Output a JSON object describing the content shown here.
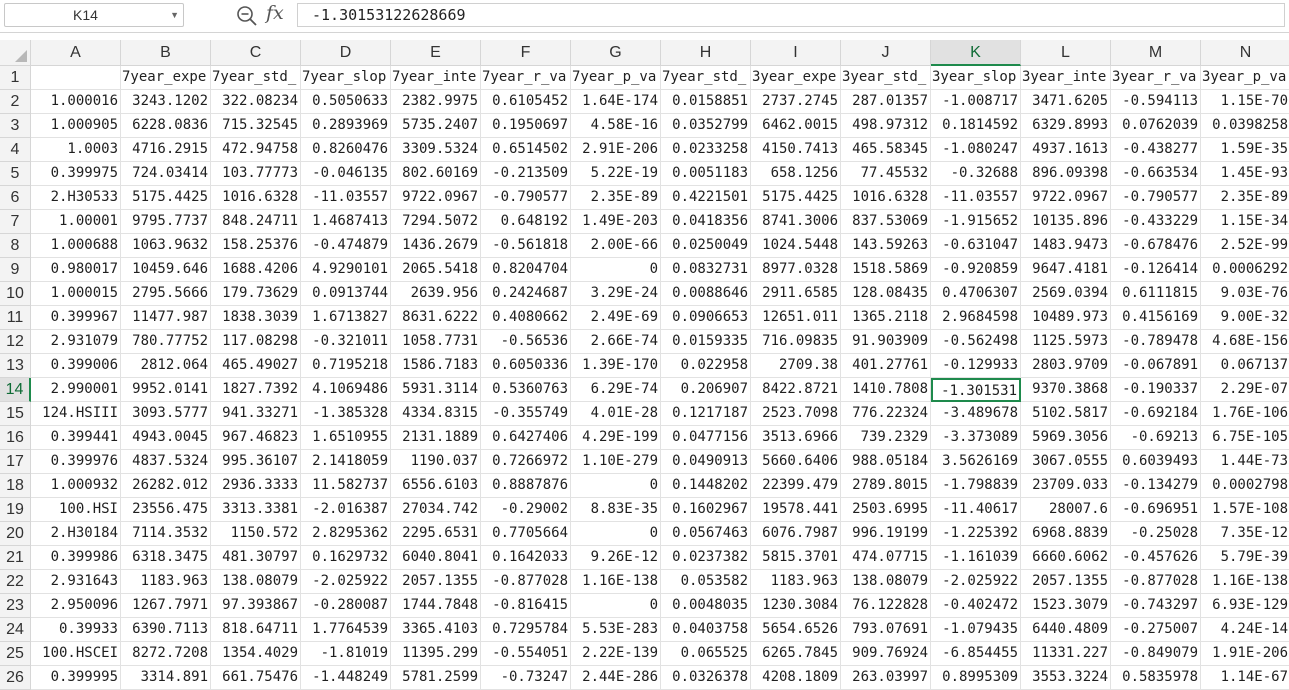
{
  "formula_bar": {
    "name_box": "K14",
    "fx_label": "fx",
    "formula_value": "-1.30153122628669"
  },
  "sheet": {
    "active_cell": {
      "row": 13,
      "col": 10
    },
    "columns": [
      "A",
      "B",
      "C",
      "D",
      "E",
      "F",
      "G",
      "H",
      "I",
      "J",
      "K",
      "L",
      "M",
      "N"
    ],
    "row_numbers": [
      "1",
      "2",
      "3",
      "4",
      "5",
      "6",
      "7",
      "8",
      "9",
      "10",
      "11",
      "12",
      "13",
      "14",
      "15",
      "16",
      "17",
      "18",
      "19",
      "20",
      "21",
      "22",
      "23",
      "24",
      "25",
      "26"
    ],
    "rows": [
      [
        "",
        "7year_expe",
        "7year_std_",
        "7year_slop",
        "7year_inte",
        "7year_r_va",
        "7year_p_va",
        "7year_std_",
        "3year_expe",
        "3year_std_",
        "3year_slop",
        "3year_inte",
        "3year_r_va",
        "3year_p_va"
      ],
      [
        "1.000016",
        "3243.1202",
        "322.08234",
        "0.5050633",
        "2382.9975",
        "0.6105452",
        "1.64E-174",
        "0.0158851",
        "2737.2745",
        "287.01357",
        "-1.008717",
        "3471.6205",
        "-0.594113",
        "1.15E-70"
      ],
      [
        "1.000905",
        "6228.0836",
        "715.32545",
        "0.2893969",
        "5735.2407",
        "0.1950697",
        "4.58E-16",
        "0.0352799",
        "6462.0015",
        "498.97312",
        "0.1814592",
        "6329.8993",
        "0.0762039",
        "0.0398258"
      ],
      [
        "1.0003",
        "4716.2915",
        "472.94758",
        "0.8260476",
        "3309.5324",
        "0.6514502",
        "2.91E-206",
        "0.0233258",
        "4150.7413",
        "465.58345",
        "-1.080247",
        "4937.1613",
        "-0.438277",
        "1.59E-35"
      ],
      [
        "0.399975",
        "724.03414",
        "103.77773",
        "-0.046135",
        "802.60169",
        "-0.213509",
        "5.22E-19",
        "0.0051183",
        "658.1256",
        "77.45532",
        "-0.32688",
        "896.09398",
        "-0.663534",
        "1.45E-93"
      ],
      [
        "2.H30533",
        "5175.4425",
        "1016.6328",
        "-11.03557",
        "9722.0967",
        "-0.790577",
        "2.35E-89",
        "0.4221501",
        "5175.4425",
        "1016.6328",
        "-11.03557",
        "9722.0967",
        "-0.790577",
        "2.35E-89"
      ],
      [
        "1.00001",
        "9795.7737",
        "848.24711",
        "1.4687413",
        "7294.5072",
        "0.648192",
        "1.49E-203",
        "0.0418356",
        "8741.3006",
        "837.53069",
        "-1.915652",
        "10135.896",
        "-0.433229",
        "1.15E-34"
      ],
      [
        "1.000688",
        "1063.9632",
        "158.25376",
        "-0.474879",
        "1436.2679",
        "-0.561818",
        "2.00E-66",
        "0.0250049",
        "1024.5448",
        "143.59263",
        "-0.631047",
        "1483.9473",
        "-0.678476",
        "2.52E-99"
      ],
      [
        "0.980017",
        "10459.646",
        "1688.4206",
        "4.9290101",
        "2065.5418",
        "0.8204704",
        "0",
        "0.0832731",
        "8977.0328",
        "1518.5869",
        "-0.920859",
        "9647.4181",
        "-0.126414",
        "0.0006292"
      ],
      [
        "1.000015",
        "2795.5666",
        "179.73629",
        "0.0913744",
        "2639.956",
        "0.2424687",
        "3.29E-24",
        "0.0088646",
        "2911.6585",
        "128.08435",
        "0.4706307",
        "2569.0394",
        "0.6111815",
        "9.03E-76"
      ],
      [
        "0.399967",
        "11477.987",
        "1838.3039",
        "1.6713827",
        "8631.6222",
        "0.4080662",
        "2.49E-69",
        "0.0906653",
        "12651.011",
        "1365.2118",
        "2.9684598",
        "10489.973",
        "0.4156169",
        "9.00E-32"
      ],
      [
        "2.931079",
        "780.77752",
        "117.08298",
        "-0.321011",
        "1058.7731",
        "-0.56536",
        "2.66E-74",
        "0.0159335",
        "716.09835",
        "91.903909",
        "-0.562498",
        "1125.5973",
        "-0.789478",
        "4.68E-156"
      ],
      [
        "0.399006",
        "2812.064",
        "465.49027",
        "0.7195218",
        "1586.7183",
        "0.6050336",
        "1.39E-170",
        "0.022958",
        "2709.38",
        "401.27761",
        "-0.129933",
        "2803.9709",
        "-0.067891",
        "0.067137"
      ],
      [
        "2.990001",
        "9952.0141",
        "1827.7392",
        "4.1069486",
        "5931.3114",
        "0.5360763",
        "6.29E-74",
        "0.206907",
        "8422.8721",
        "1410.7808",
        "-1.301531",
        "9370.3868",
        "-0.190337",
        "2.29E-07"
      ],
      [
        "124.HSIII",
        "3093.5777",
        "941.33271",
        "-1.385328",
        "4334.8315",
        "-0.355749",
        "4.01E-28",
        "0.1217187",
        "2523.7098",
        "776.22324",
        "-3.489678",
        "5102.5817",
        "-0.692184",
        "1.76E-106"
      ],
      [
        "0.399441",
        "4943.0045",
        "967.46823",
        "1.6510955",
        "2131.1889",
        "0.6427406",
        "4.29E-199",
        "0.0477156",
        "3513.6966",
        "739.2329",
        "-3.373089",
        "5969.3056",
        "-0.69213",
        "6.75E-105"
      ],
      [
        "0.399976",
        "4837.5324",
        "995.36107",
        "2.1418059",
        "1190.037",
        "0.7266972",
        "1.10E-279",
        "0.0490913",
        "5660.6406",
        "988.05184",
        "3.5626169",
        "3067.0555",
        "0.6039493",
        "1.44E-73"
      ],
      [
        "1.000932",
        "26282.012",
        "2936.3333",
        "11.582737",
        "6556.6103",
        "0.8887876",
        "0",
        "0.1448202",
        "22399.479",
        "2789.8015",
        "-1.798839",
        "23709.033",
        "-0.134279",
        "0.0002798"
      ],
      [
        "100.HSI",
        "23556.475",
        "3313.3381",
        "-2.016387",
        "27034.742",
        "-0.29002",
        "8.83E-35",
        "0.1602967",
        "19578.441",
        "2503.6995",
        "-11.40617",
        "28007.6",
        "-0.696951",
        "1.57E-108"
      ],
      [
        "2.H30184",
        "7114.3532",
        "1150.572",
        "2.8295362",
        "2295.6531",
        "0.7705664",
        "0",
        "0.0567463",
        "6076.7987",
        "996.19199",
        "-1.225392",
        "6968.8839",
        "-0.25028",
        "7.35E-12"
      ],
      [
        "0.399986",
        "6318.3475",
        "481.30797",
        "0.1629732",
        "6040.8041",
        "0.1642033",
        "9.26E-12",
        "0.0237382",
        "5815.3701",
        "474.07715",
        "-1.161039",
        "6660.6062",
        "-0.457626",
        "5.79E-39"
      ],
      [
        "2.931643",
        "1183.963",
        "138.08079",
        "-2.025922",
        "2057.1355",
        "-0.877028",
        "1.16E-138",
        "0.053582",
        "1183.963",
        "138.08079",
        "-2.025922",
        "2057.1355",
        "-0.877028",
        "1.16E-138"
      ],
      [
        "2.950096",
        "1267.7971",
        "97.393867",
        "-0.280087",
        "1744.7848",
        "-0.816415",
        "0",
        "0.0048035",
        "1230.3084",
        "76.122828",
        "-0.402472",
        "1523.3079",
        "-0.743297",
        "6.93E-129"
      ],
      [
        "0.39933",
        "6390.7113",
        "818.64711",
        "1.7764539",
        "3365.4103",
        "0.7295784",
        "5.53E-283",
        "0.0403758",
        "5654.6526",
        "793.07691",
        "-1.079435",
        "6440.4809",
        "-0.275007",
        "4.24E-14"
      ],
      [
        "100.HSCEI",
        "8272.7208",
        "1354.4029",
        "-1.81019",
        "11395.299",
        "-0.554051",
        "2.22E-139",
        "0.065525",
        "6265.7845",
        "909.76924",
        "-6.854455",
        "11331.227",
        "-0.849079",
        "1.91E-206"
      ],
      [
        "0.399995",
        "3314.891",
        "661.75476",
        "-1.448249",
        "5781.2599",
        "-0.73247",
        "2.44E-286",
        "0.0326378",
        "4208.1809",
        "263.03997",
        "0.8995309",
        "3553.3224",
        "0.5835978",
        "1.14E-67"
      ]
    ]
  }
}
